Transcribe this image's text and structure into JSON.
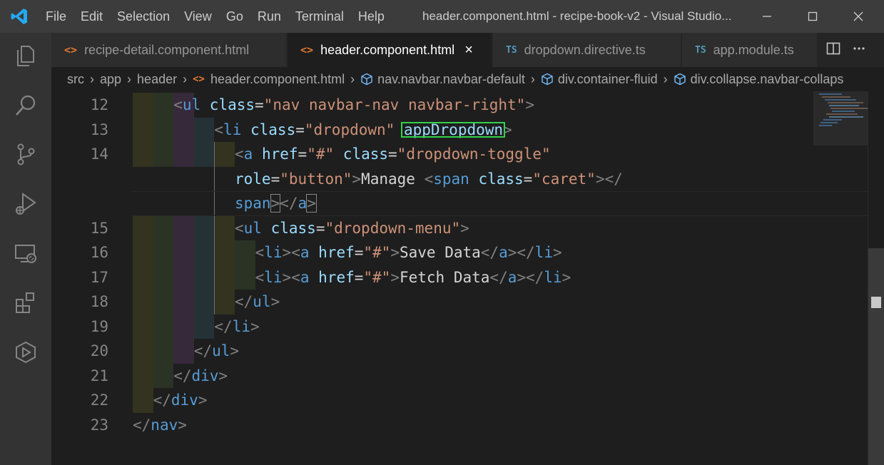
{
  "window": {
    "title": "header.component.html - recipe-book-v2 - Visual Studio...",
    "menu": [
      "File",
      "Edit",
      "Selection",
      "View",
      "Go",
      "Run",
      "Terminal",
      "Help"
    ]
  },
  "tabs": [
    {
      "label": "recipe-detail.component.html",
      "icon": "html",
      "active": false
    },
    {
      "label": "header.component.html",
      "icon": "html",
      "active": true
    },
    {
      "label": "dropdown.directive.ts",
      "icon": "TS",
      "active": false
    },
    {
      "label": "app.module.ts",
      "icon": "TS",
      "active": false
    }
  ],
  "breadcrumb": [
    "src",
    "app",
    "header",
    "header.component.html",
    "nav.navbar.navbar-default",
    "div.container-fluid",
    "div.collapse.navbar-collaps"
  ],
  "editor": {
    "line_numbers": [
      "12",
      "13",
      "14",
      "",
      "",
      "15",
      "16",
      "17",
      "18",
      "19",
      "20",
      "21",
      "22",
      "23"
    ],
    "lines": [
      [
        [
          "br",
          "<"
        ],
        [
          "tg",
          "ul"
        ],
        [
          "tx",
          " "
        ],
        [
          "at",
          "class"
        ],
        [
          "tx",
          "="
        ],
        [
          "st",
          "\"nav navbar-nav navbar-right\""
        ],
        [
          "br",
          ">"
        ]
      ],
      [
        [
          "br",
          "<"
        ],
        [
          "tg",
          "li"
        ],
        [
          "tx",
          " "
        ],
        [
          "at",
          "class"
        ],
        [
          "tx",
          "="
        ],
        [
          "st",
          "\"dropdown\""
        ],
        [
          "tx",
          " "
        ],
        [
          "at",
          "appDropdown"
        ],
        [
          "br",
          ">"
        ]
      ],
      [
        [
          "br",
          "<"
        ],
        [
          "tg",
          "a"
        ],
        [
          "tx",
          " "
        ],
        [
          "at",
          "href"
        ],
        [
          "tx",
          "="
        ],
        [
          "st",
          "\"#\""
        ],
        [
          "tx",
          " "
        ],
        [
          "at",
          "class"
        ],
        [
          "tx",
          "="
        ],
        [
          "st",
          "\"dropdown-toggle\""
        ]
      ],
      [
        [
          "at",
          "role"
        ],
        [
          "tx",
          "="
        ],
        [
          "st",
          "\"button\""
        ],
        [
          "br",
          ">"
        ],
        [
          "tx",
          "Manage "
        ],
        [
          "br",
          "<"
        ],
        [
          "tg",
          "span"
        ],
        [
          "tx",
          " "
        ],
        [
          "at",
          "class"
        ],
        [
          "tx",
          "="
        ],
        [
          "st",
          "\"caret\""
        ],
        [
          "br",
          "></"
        ]
      ],
      [
        [
          "tg",
          "span"
        ],
        [
          "br",
          ">"
        ],
        [
          "br",
          "</"
        ],
        [
          "tg",
          "a"
        ],
        [
          "br",
          ">"
        ]
      ],
      [
        [
          "br",
          "<"
        ],
        [
          "tg",
          "ul"
        ],
        [
          "tx",
          " "
        ],
        [
          "at",
          "class"
        ],
        [
          "tx",
          "="
        ],
        [
          "st",
          "\"dropdown-menu\""
        ],
        [
          "br",
          ">"
        ]
      ],
      [
        [
          "br",
          "<"
        ],
        [
          "tg",
          "li"
        ],
        [
          "br",
          "><"
        ],
        [
          "tg",
          "a"
        ],
        [
          "tx",
          " "
        ],
        [
          "at",
          "href"
        ],
        [
          "tx",
          "="
        ],
        [
          "st",
          "\"#\""
        ],
        [
          "br",
          ">"
        ],
        [
          "tx",
          "Save Data"
        ],
        [
          "br",
          "</"
        ],
        [
          "tg",
          "a"
        ],
        [
          "br",
          "></"
        ],
        [
          "tg",
          "li"
        ],
        [
          "br",
          ">"
        ]
      ],
      [
        [
          "br",
          "<"
        ],
        [
          "tg",
          "li"
        ],
        [
          "br",
          "><"
        ],
        [
          "tg",
          "a"
        ],
        [
          "tx",
          " "
        ],
        [
          "at",
          "href"
        ],
        [
          "tx",
          "="
        ],
        [
          "st",
          "\"#\""
        ],
        [
          "br",
          ">"
        ],
        [
          "tx",
          "Fetch Data"
        ],
        [
          "br",
          "</"
        ],
        [
          "tg",
          "a"
        ],
        [
          "br",
          "></"
        ],
        [
          "tg",
          "li"
        ],
        [
          "br",
          ">"
        ]
      ],
      [
        [
          "br",
          "</"
        ],
        [
          "tg",
          "ul"
        ],
        [
          "br",
          ">"
        ]
      ],
      [
        [
          "br",
          "</"
        ],
        [
          "tg",
          "li"
        ],
        [
          "br",
          ">"
        ]
      ],
      [
        [
          "br",
          "</"
        ],
        [
          "tg",
          "ul"
        ],
        [
          "br",
          ">"
        ]
      ],
      [
        [
          "br",
          "</"
        ],
        [
          "tg",
          "div"
        ],
        [
          "br",
          ">"
        ]
      ],
      [
        [
          "br",
          "</"
        ],
        [
          "tg",
          "div"
        ],
        [
          "br",
          ">"
        ]
      ],
      [
        [
          "br",
          "</"
        ],
        [
          "tg",
          "nav"
        ],
        [
          "br",
          ">"
        ]
      ]
    ],
    "highlighted_token": "appDropdown"
  },
  "colors": {
    "tag": "#569cd6",
    "attribute": "#9cdcfe",
    "string": "#ce9178",
    "bracket": "#808080",
    "text": "#d4d4d4",
    "highlight_border": "#33d14a"
  }
}
